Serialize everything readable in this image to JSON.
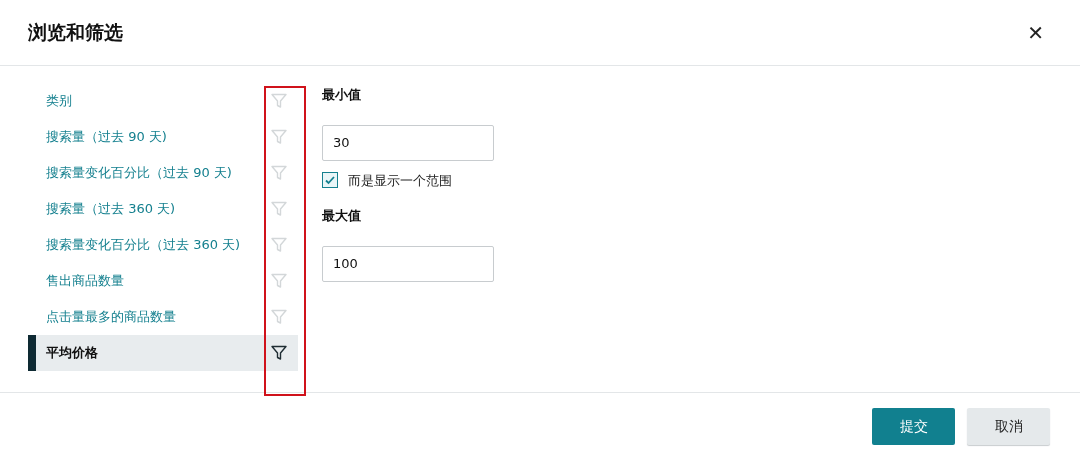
{
  "dialog": {
    "title": "浏览和筛选",
    "close": "✕"
  },
  "fields": [
    {
      "label": "类别",
      "selected": false
    },
    {
      "label": "搜索量（过去 90 天)",
      "selected": false
    },
    {
      "label": "搜索量变化百分比（过去 90 天)",
      "selected": false
    },
    {
      "label": "搜索量（过去 360 天)",
      "selected": false
    },
    {
      "label": "搜索量变化百分比（过去 360 天)",
      "selected": false
    },
    {
      "label": "售出商品数量",
      "selected": false
    },
    {
      "label": "点击量最多的商品数量",
      "selected": false
    },
    {
      "label": "平均价格",
      "selected": true
    }
  ],
  "filter": {
    "min_label": "最小值",
    "min_value": "30",
    "range_label": "而是显示一个范围",
    "range_checked": true,
    "max_label": "最大值",
    "max_value": "100"
  },
  "buttons": [
    {
      "label": "提交",
      "kind": "primary"
    },
    {
      "label": "取消",
      "kind": "secondary"
    }
  ]
}
